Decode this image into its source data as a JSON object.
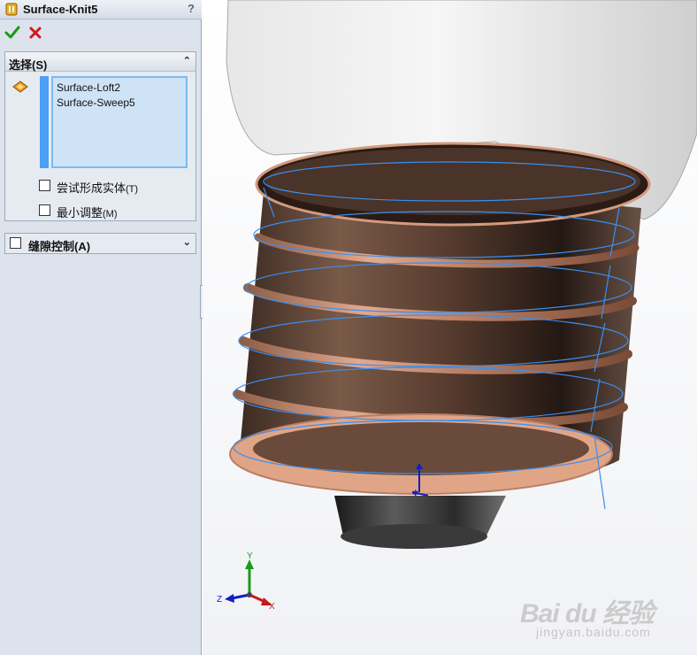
{
  "property_manager": {
    "title": "Surface-Knit5",
    "help": "?",
    "selections_group": {
      "title": "选择(S)",
      "items": [
        "Surface-Loft2",
        "Surface-Sweep5"
      ],
      "try_solid_label": "尝试形成实体",
      "try_solid_key": "(T)",
      "min_adjust_label": "最小调整",
      "min_adjust_key": "(M)"
    },
    "gap_group": {
      "title": "缝隙控制(A)"
    }
  },
  "triad": {
    "x": "X",
    "y": "Y",
    "z": "Z"
  },
  "watermark": {
    "logo": "Bai du 经验",
    "url": "jingyan.baidu.com"
  },
  "colors": {
    "panel_bg": "#dce3ec",
    "selection_list_bg": "#cfe3f7",
    "accent_blue": "#4d9ef5",
    "helix_curve": "#3a8ff0",
    "thread_copper": "#c7907a",
    "bulb_glass": "#d9d9d9"
  }
}
